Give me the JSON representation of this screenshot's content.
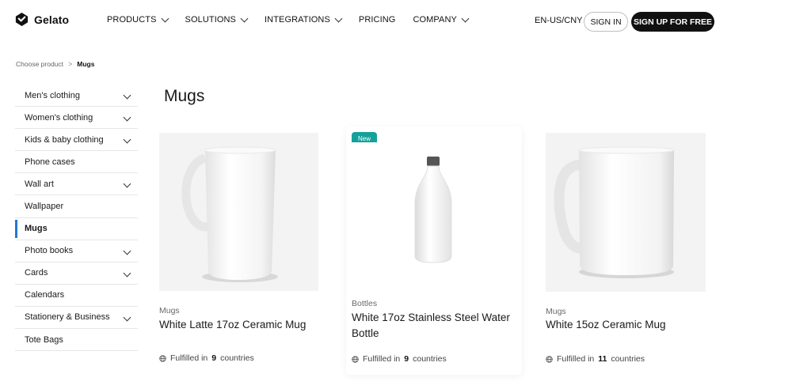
{
  "brand": {
    "name": "Gelato"
  },
  "nav": {
    "items": [
      {
        "label": "PRODUCTS",
        "dropdown": true
      },
      {
        "label": "SOLUTIONS",
        "dropdown": true
      },
      {
        "label": "INTEGRATIONS",
        "dropdown": true
      },
      {
        "label": "PRICING",
        "dropdown": false
      },
      {
        "label": "COMPANY",
        "dropdown": true
      }
    ],
    "locale": "EN-US/CNY",
    "sign_in": "SIGN IN",
    "sign_up": "SIGN UP FOR FREE"
  },
  "breadcrumb": {
    "root": "Choose product",
    "separator": ">",
    "current": "Mugs"
  },
  "sidebar": {
    "items": [
      {
        "label": "Men's clothing",
        "expandable": true
      },
      {
        "label": "Women's clothing",
        "expandable": true
      },
      {
        "label": "Kids & baby clothing",
        "expandable": true
      },
      {
        "label": "Phone cases",
        "expandable": false
      },
      {
        "label": "Wall art",
        "expandable": true
      },
      {
        "label": "Wallpaper",
        "expandable": false
      },
      {
        "label": "Mugs",
        "expandable": false,
        "active": true
      },
      {
        "label": "Photo books",
        "expandable": true
      },
      {
        "label": "Cards",
        "expandable": true
      },
      {
        "label": "Calendars",
        "expandable": false
      },
      {
        "label": "Stationery & Business",
        "expandable": true
      },
      {
        "label": "Tote Bags",
        "expandable": false
      }
    ]
  },
  "main": {
    "title": "Mugs",
    "products": [
      {
        "category": "Mugs",
        "title": "White Latte 17oz Ceramic Mug",
        "fulfilled_prefix": "Fulfilled in",
        "countries": "9",
        "fulfilled_suffix": "countries",
        "image": "latte-mug"
      },
      {
        "badge": "New",
        "category": "Bottles",
        "title": "White 17oz Stainless Steel Water Bottle",
        "fulfilled_prefix": "Fulfilled in",
        "countries": "9",
        "fulfilled_suffix": "countries",
        "image": "water-bottle"
      },
      {
        "category": "Mugs",
        "title": "White 15oz Ceramic Mug",
        "fulfilled_prefix": "Fulfilled in",
        "countries": "11",
        "fulfilled_suffix": "countries",
        "image": "ceramic-mug"
      }
    ]
  },
  "colors": {
    "accent": "#1e7ad6",
    "badge": "#14a19a",
    "signup_bg": "#111111"
  }
}
